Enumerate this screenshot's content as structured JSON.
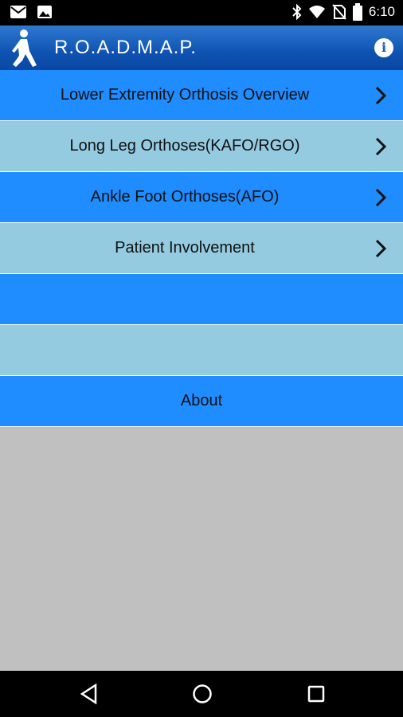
{
  "status_bar": {
    "left_icons": [
      "gmail-icon",
      "image-icon"
    ],
    "right_icons": [
      "bluetooth-icon",
      "wifi-icon",
      "no-sim-icon",
      "battery-icon"
    ],
    "time": "6:10"
  },
  "app_bar": {
    "title": "R.O.A.D.M.A.P.",
    "logo_icon": "walking-person-icon",
    "info_icon": "info-icon",
    "info_label": "i"
  },
  "menu": {
    "items": [
      {
        "label": "Lower Extremity Orthosis Overview",
        "has_chevron": true,
        "color": "#1f8cff"
      },
      {
        "label": "Long Leg Orthoses(KAFO/RGO)",
        "has_chevron": true,
        "color": "#94cbe0"
      },
      {
        "label": "Ankle Foot Orthoses(AFO)",
        "has_chevron": true,
        "color": "#1f8cff"
      },
      {
        "label": "Patient Involvement",
        "has_chevron": true,
        "color": "#94cbe0"
      },
      {
        "label": "",
        "has_chevron": false,
        "color": "#1f8cff"
      },
      {
        "label": "",
        "has_chevron": false,
        "color": "#94cbe0"
      },
      {
        "label": "About",
        "has_chevron": false,
        "color": "#1f8cff"
      }
    ]
  },
  "nav_bar": {
    "back_icon": "back-triangle-icon",
    "home_icon": "home-circle-icon",
    "recents_icon": "recents-square-icon"
  }
}
